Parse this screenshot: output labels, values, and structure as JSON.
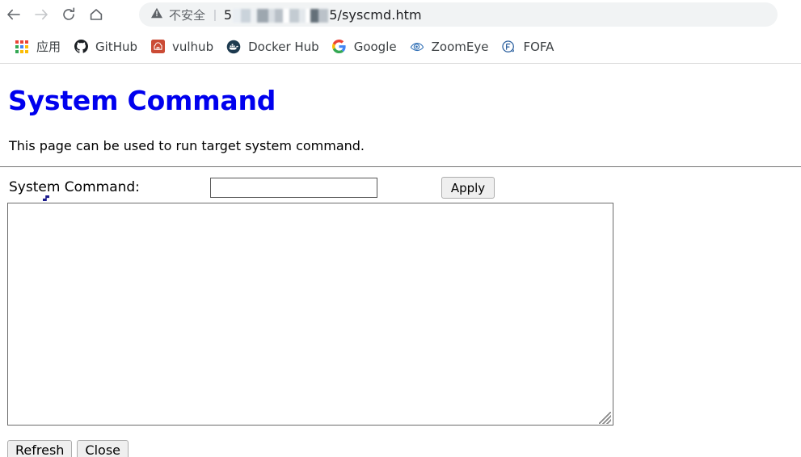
{
  "browser": {
    "nav": {
      "back_icon": "arrow-left-icon",
      "forward_icon": "arrow-right-icon",
      "reload_icon": "reload-icon",
      "home_icon": "home-icon"
    },
    "omnibox": {
      "security_icon": "warning-triangle-icon",
      "security_label": "不安全",
      "separator": "|",
      "url_prefix": "5",
      "url_redacted": "",
      "url_suffix": "5/syscmd.htm"
    },
    "bookmarks": [
      {
        "label": "应用",
        "icon": "apps-grid-icon"
      },
      {
        "label": "GitHub",
        "icon": "github-icon"
      },
      {
        "label": "vulhub",
        "icon": "vulhub-icon"
      },
      {
        "label": "Docker Hub",
        "icon": "docker-icon"
      },
      {
        "label": "Google",
        "icon": "google-icon"
      },
      {
        "label": "ZoomEye",
        "icon": "zoomeye-eye-icon"
      },
      {
        "label": "FOFA",
        "icon": "fofa-icon"
      }
    ]
  },
  "page": {
    "title": "System Command",
    "description": "This page can be used to run target system command.",
    "command_label": "System Command:",
    "command_value": "",
    "command_placeholder": "",
    "apply_label": "Apply",
    "output_value": "",
    "refresh_label": "Refresh",
    "close_label": "Close"
  },
  "colors": {
    "title": "#0000ee",
    "omnibox_bg": "#f1f3f4",
    "button_bg": "#efefef",
    "vulhub_accent": "#cb4b35",
    "zoomeye_accent": "#2f6fb5",
    "fofa_accent": "#2a5f9e"
  }
}
